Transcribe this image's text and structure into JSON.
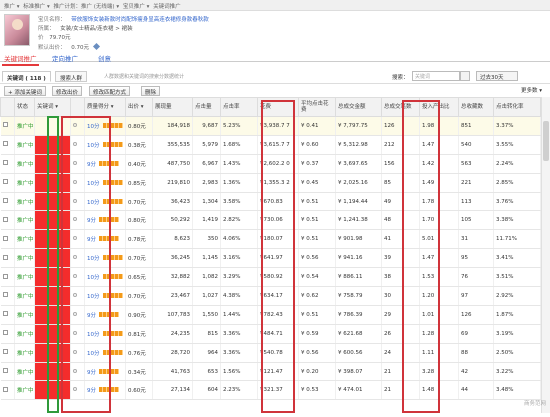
{
  "breadcrumb": [
    "推广 ▾",
    "标准推广 ▾",
    "推广计划：推广 (无线端) ▾",
    "宝贝推广 ▾",
    "关键词推广"
  ],
  "product": {
    "title_label": "宝贝名称：",
    "title": "带放服饰女装新款时尚配饰瘦身显高连衣裙修身款春秋款",
    "category_label": "所属：",
    "category": "女装/女士精品/连衣裙 > 裙装",
    "price_label": "价",
    "price": "79.70元",
    "budget_label": "默认出价：",
    "budget": "0.70元"
  },
  "sub_tabs": [
    {
      "label": "关键词推广",
      "active": true
    },
    {
      "label": "定向推广",
      "active": false
    },
    {
      "label": "创意",
      "active": false
    }
  ],
  "tabs": {
    "keyword": "关键词 ( 118 )",
    "crowd": "搜索人群",
    "hint": "人群数据和关键词的搜索分数据统计"
  },
  "search": {
    "label": "搜索：",
    "placeholder": "关键词",
    "date": "过去30天"
  },
  "actions": {
    "add_keyword": "+ 添加关键词",
    "modify_price": "修改出价",
    "change_match": "修改匹配方式",
    "delete": "删除",
    "more_data": "更多数 ▾"
  },
  "columns": [
    "状态",
    "关键词 ▾",
    "",
    "质量得分 ▾",
    "出价 ▾",
    "展现量",
    "点击量",
    "点击率",
    "花费",
    "平均点击花费",
    "总成交金额",
    "总成交笔数",
    "投入产出比",
    "总收藏数",
    "点击转化率"
  ],
  "rows": [
    {
      "status": "推广中",
      "score": "10分",
      "bid": "0.80元",
      "impr": "184,918",
      "clicks": "9,687",
      "ctr": "5.23%",
      "cost": "¥3,938.7 7",
      "cpc": "¥ 0.41",
      "gmv": "¥ 7,797.75",
      "orders": "126",
      "roi": "1.98",
      "fav": "851",
      "cvr": "3.37%"
    },
    {
      "status": "推广中",
      "score": "10分",
      "bid": "0.38元",
      "impr": "355,535",
      "clicks": "5,979",
      "ctr": "1.68%",
      "cost": "¥3,615.7 7",
      "cpc": "¥ 0.60",
      "gmv": "¥ 5,312.98",
      "orders": "212",
      "roi": "1.47",
      "fav": "540",
      "cvr": "3.55%"
    },
    {
      "status": "推广中",
      "score": "9分",
      "bid": "0.40元",
      "impr": "487,750",
      "clicks": "6,967",
      "ctr": "1.43%",
      "cost": "¥2,602.2 0",
      "cpc": "¥ 0.37",
      "gmv": "¥ 3,697.65",
      "orders": "156",
      "roi": "1.42",
      "fav": "563",
      "cvr": "2.24%"
    },
    {
      "status": "推广中",
      "score": "10分",
      "bid": "0.85元",
      "impr": "219,810",
      "clicks": "2,983",
      "ctr": "1.36%",
      "cost": "¥1,355.3 2",
      "cpc": "¥ 0.45",
      "gmv": "¥ 2,025.16",
      "orders": "85",
      "roi": "1.49",
      "fav": "221",
      "cvr": "2.85%"
    },
    {
      "status": "推广中",
      "score": "10分",
      "bid": "0.70元",
      "impr": "36,423",
      "clicks": "1,304",
      "ctr": "3.58%",
      "cost": "¥670.83",
      "cpc": "¥ 0.51",
      "gmv": "¥ 1,194.44",
      "orders": "49",
      "roi": "1.78",
      "fav": "113",
      "cvr": "3.76%"
    },
    {
      "status": "推广中",
      "score": "9分",
      "bid": "0.80元",
      "impr": "50,292",
      "clicks": "1,419",
      "ctr": "2.82%",
      "cost": "¥730.06",
      "cpc": "¥ 0.51",
      "gmv": "¥ 1,241.38",
      "orders": "48",
      "roi": "1.70",
      "fav": "105",
      "cvr": "3.38%"
    },
    {
      "status": "推广中",
      "score": "9分",
      "bid": "0.78元",
      "impr": "8,623",
      "clicks": "350",
      "ctr": "4.06%",
      "cost": "¥180.07",
      "cpc": "¥ 0.51",
      "gmv": "¥ 901.98",
      "orders": "41",
      "roi": "5.01",
      "fav": "31",
      "cvr": "11.71%"
    },
    {
      "status": "推广中",
      "score": "10分",
      "bid": "0.70元",
      "impr": "36,245",
      "clicks": "1,145",
      "ctr": "3.16%",
      "cost": "¥641.97",
      "cpc": "¥ 0.56",
      "gmv": "¥ 941.16",
      "orders": "39",
      "roi": "1.47",
      "fav": "95",
      "cvr": "3.41%"
    },
    {
      "status": "推广中",
      "score": "10分",
      "bid": "0.65元",
      "impr": "32,882",
      "clicks": "1,082",
      "ctr": "3.29%",
      "cost": "¥580.92",
      "cpc": "¥ 0.54",
      "gmv": "¥ 886.11",
      "orders": "38",
      "roi": "1.53",
      "fav": "76",
      "cvr": "3.51%"
    },
    {
      "status": "推广中",
      "score": "10分",
      "bid": "0.70元",
      "impr": "23,467",
      "clicks": "1,027",
      "ctr": "4.38%",
      "cost": "¥634.17",
      "cpc": "¥ 0.62",
      "gmv": "¥ 758.79",
      "orders": "30",
      "roi": "1.20",
      "fav": "97",
      "cvr": "2.92%"
    },
    {
      "status": "推广中",
      "score": "9分",
      "bid": "0.90元",
      "impr": "107,783",
      "clicks": "1,550",
      "ctr": "1.44%",
      "cost": "¥782.43",
      "cpc": "¥ 0.51",
      "gmv": "¥ 786.39",
      "orders": "29",
      "roi": "1.01",
      "fav": "126",
      "cvr": "1.87%"
    },
    {
      "status": "推广中",
      "score": "10分",
      "bid": "0.81元",
      "impr": "24,235",
      "clicks": "815",
      "ctr": "3.36%",
      "cost": "¥484.71",
      "cpc": "¥ 0.59",
      "gmv": "¥ 621.68",
      "orders": "26",
      "roi": "1.28",
      "fav": "69",
      "cvr": "3.19%"
    },
    {
      "status": "推广中",
      "score": "10分",
      "bid": "0.76元",
      "impr": "28,720",
      "clicks": "964",
      "ctr": "3.36%",
      "cost": "¥540.78",
      "cpc": "¥ 0.56",
      "gmv": "¥ 600.56",
      "orders": "24",
      "roi": "1.11",
      "fav": "88",
      "cvr": "2.50%"
    },
    {
      "status": "推广中",
      "score": "9分",
      "bid": "0.34元",
      "impr": "41,763",
      "clicks": "653",
      "ctr": "1.56%",
      "cost": "¥121.47",
      "cpc": "¥ 0.20",
      "gmv": "¥ 398.07",
      "orders": "21",
      "roi": "3.28",
      "fav": "42",
      "cvr": "3.22%"
    },
    {
      "status": "推广中",
      "score": "9分",
      "bid": "0.60元",
      "impr": "27,134",
      "clicks": "604",
      "ctr": "2.23%",
      "cost": "¥321.37",
      "cpc": "¥ 0.53",
      "gmv": "¥ 474.01",
      "orders": "21",
      "roi": "1.48",
      "fav": "44",
      "cvr": "3.48%"
    }
  ],
  "colors": {
    "highlight": "#d0333a",
    "keyword_mask": "#f42c2c",
    "status_green": "#2a9a2a",
    "link_blue": "#3366cc"
  },
  "watermark": "商务范网"
}
